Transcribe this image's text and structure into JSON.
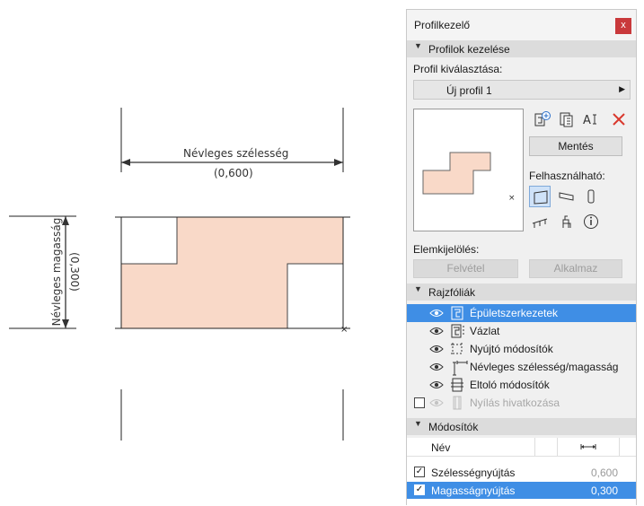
{
  "canvas": {
    "width_label": "Névleges szélesség",
    "width_value": "(0,600)",
    "height_label": "Névleges magasság",
    "height_value": "(0,300)"
  },
  "panel": {
    "title": "Profilkezelő",
    "close": "x",
    "sections": {
      "manage": "Profilok kezelése",
      "layers": "Rajzfóliák",
      "modifiers": "Módosítók"
    },
    "select_profile_label": "Profil kiválasztása:",
    "profile_value": "Új profil 1",
    "save_button": "Mentés",
    "usable_label": "Felhasználható:",
    "element_select_label": "Elemkijelölés:",
    "pick_button": "Felvétel",
    "apply_button": "Alkalmaz",
    "layers": [
      {
        "label": "Épületszerkezetek",
        "selected": true,
        "visible": true
      },
      {
        "label": "Vázlat",
        "selected": false,
        "visible": true
      },
      {
        "label": "Nyújtó módosítók",
        "selected": false,
        "visible": true
      },
      {
        "label": "Névleges szélesség/magasság",
        "selected": false,
        "visible": true
      },
      {
        "label": "Eltoló módosítók",
        "selected": false,
        "visible": true
      },
      {
        "label": "Nyílás hivatkozása",
        "selected": false,
        "visible": false
      }
    ],
    "modifiers_table": {
      "name_header": "Név",
      "rows": [
        {
          "name": "Szélességnyújtás",
          "value": "0,600",
          "checked": true
        },
        {
          "name": "Magasságnyújtás",
          "value": "0,300",
          "checked": true
        }
      ]
    }
  },
  "colors": {
    "accent": "#3f8ee5",
    "profile_fill": "#f9d9c8",
    "close_red": "#c9393b"
  }
}
